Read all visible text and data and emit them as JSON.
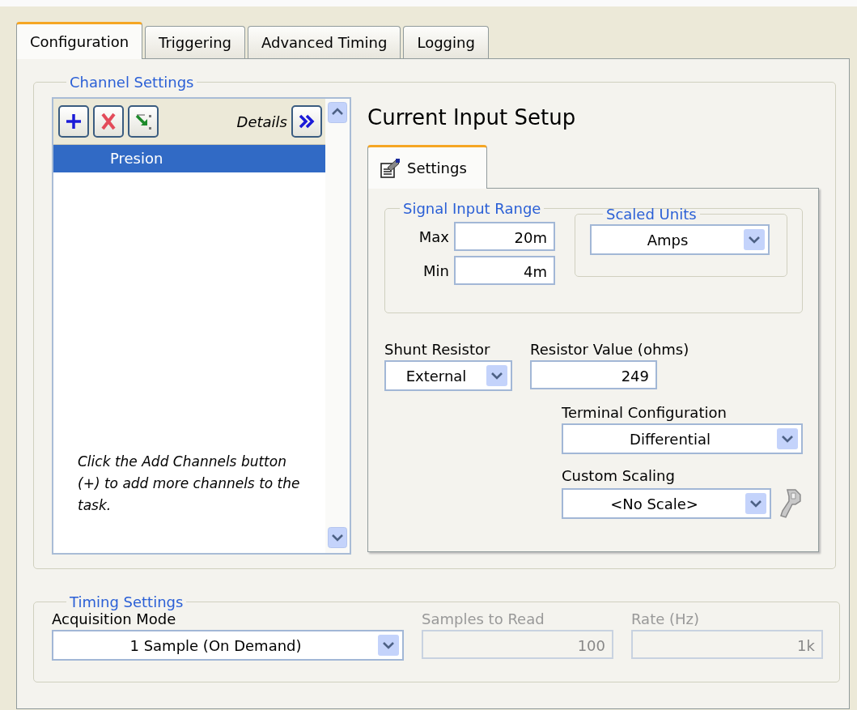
{
  "tabs": [
    {
      "label": "Configuration",
      "selected": true
    },
    {
      "label": "Triggering",
      "selected": false
    },
    {
      "label": "Advanced Timing",
      "selected": false
    },
    {
      "label": "Logging",
      "selected": false
    }
  ],
  "channel_settings": {
    "title": "Channel Settings",
    "details_label": "Details",
    "channels": [
      {
        "name": "Presion",
        "selected": true
      }
    ],
    "hint": "Click the Add Channels button (+) to add more channels to the task."
  },
  "current_input_setup": {
    "title": "Current Input Setup",
    "tabs": [
      {
        "label": "Settings",
        "selected": true
      }
    ],
    "signal_input_range": {
      "title": "Signal Input Range",
      "max": {
        "label": "Max",
        "value": "20m"
      },
      "min": {
        "label": "Min",
        "value": "4m"
      }
    },
    "scaled_units": {
      "title": "Scaled Units",
      "value": "Amps"
    },
    "shunt_resistor": {
      "label": "Shunt Resistor",
      "value": "External"
    },
    "resistor_value": {
      "label": "Resistor Value (ohms)",
      "value": "249"
    },
    "terminal_configuration": {
      "label": "Terminal Configuration",
      "value": "Differential"
    },
    "custom_scaling": {
      "label": "Custom Scaling",
      "value": "<No Scale>"
    }
  },
  "timing_settings": {
    "title": "Timing Settings",
    "acquisition_mode": {
      "label": "Acquisition Mode",
      "value": "1 Sample (On Demand)",
      "disabled": false
    },
    "samples_to_read": {
      "label": "Samples to Read",
      "value": "100",
      "disabled": true
    },
    "rate": {
      "label": "Rate (Hz)",
      "value": "1k",
      "disabled": true
    }
  }
}
